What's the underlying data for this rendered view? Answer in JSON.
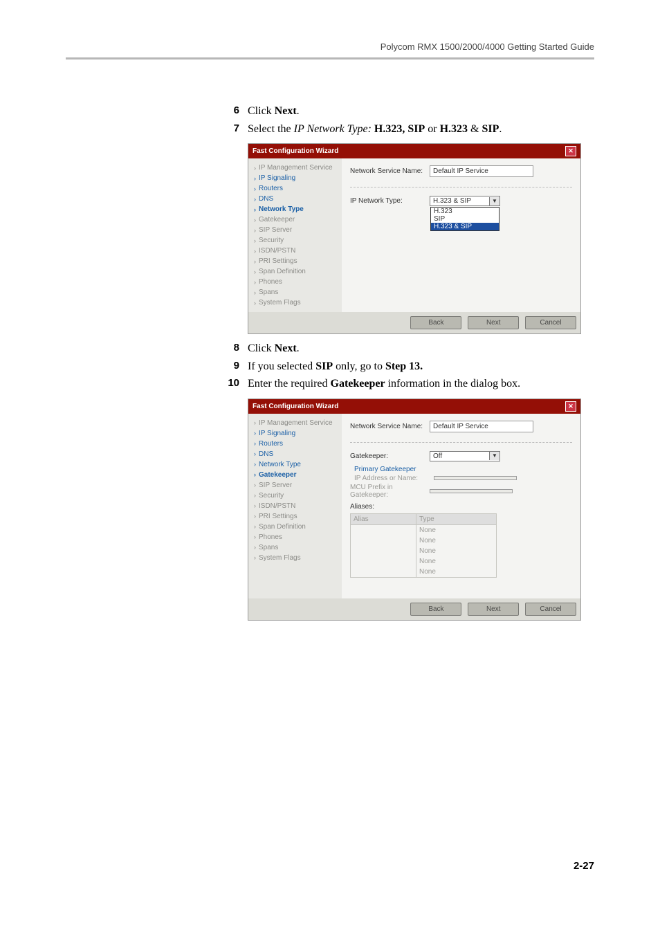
{
  "header": {
    "title": "Polycom RMX 1500/2000/4000 Getting Started Guide"
  },
  "steps": {
    "s6": {
      "num": "6",
      "prefix": "Click ",
      "bold": "Next",
      "suffix": "."
    },
    "s7": {
      "num": "7",
      "prefix": "Select the ",
      "italic": "IP Network Type:",
      "space": " ",
      "bold": "H.323, SIP",
      "mid": " or ",
      "bold2": "H.323",
      "amp": " & ",
      "bold3": "SIP",
      "suffix": "."
    },
    "s8": {
      "num": "8",
      "prefix": "Click ",
      "bold": "Next",
      "suffix": "."
    },
    "s9": {
      "num": "9",
      "prefix": "If you selected ",
      "bold": "SIP",
      "mid": " only, go to ",
      "bold2": "Step 13."
    },
    "s10": {
      "num": "10",
      "prefix": "Enter the required ",
      "bold": "Gatekeeper",
      "suffix": " information in the dialog box."
    }
  },
  "wizard_common": {
    "title": "Fast Configuration Wizard",
    "nav": {
      "ip_mgmt": "IP Management Service",
      "ip_sig": "IP Signaling",
      "routers": "Routers",
      "dns": "DNS",
      "net_type": "Network Type",
      "gatekeeper": "Gatekeeper",
      "sip_server": "SIP Server",
      "security": "Security",
      "isdn": "ISDN/PSTN",
      "pri": "PRI Settings",
      "span_def": "Span Definition",
      "phones": "Phones",
      "spans": "Spans",
      "sys_flags": "System Flags"
    },
    "buttons": {
      "back": "Back",
      "next": "Next",
      "cancel": "Cancel"
    },
    "service_name_label": "Network Service Name:",
    "service_name_value": "Default IP Service"
  },
  "wizard1": {
    "ip_net_type_label": "IP Network Type:",
    "select_value": "H.323 & SIP",
    "options": {
      "o1": "H.323",
      "o2": "SIP",
      "o3": "H.323 & SIP"
    }
  },
  "wizard2": {
    "gatekeeper_label": "Gatekeeper:",
    "gatekeeper_value": "Off",
    "primary_gk": "Primary Gatekeeper",
    "ip_addr_label": "IP Address or Name:",
    "mcu_prefix_label": "MCU Prefix in Gatekeeper:",
    "aliases_label": "Aliases:",
    "table": {
      "col1": "Alias",
      "col2": "Type",
      "none": "None"
    }
  },
  "page_number": "2-27"
}
